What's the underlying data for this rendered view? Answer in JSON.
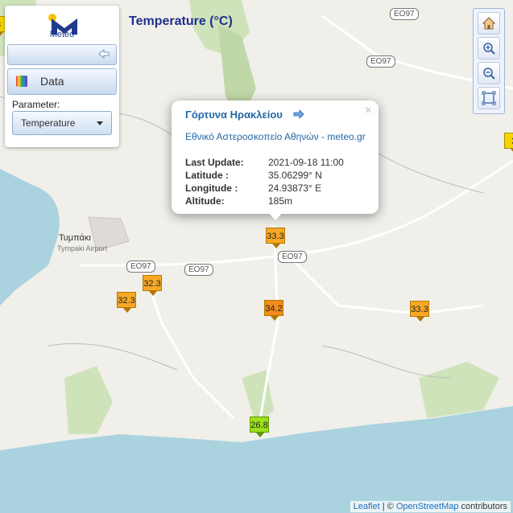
{
  "logo": {
    "text": "Meteo"
  },
  "panel": {
    "data_label": "Data",
    "parameter_label": "Parameter:",
    "parameter_value": "Temperature"
  },
  "map_title": "Temperature (°C)",
  "zoom": {
    "icons": [
      "home-icon",
      "zoom-in-icon",
      "zoom-out-icon",
      "fit-extent-icon"
    ]
  },
  "popup": {
    "station": "Γόρτυνα Ηρακλείου",
    "network": "Εθνικό Αστεροσκοπείο Αθηνών - meteo.gr",
    "rows": [
      {
        "label": "Last Update:",
        "value": "2021-09-18 11:00"
      },
      {
        "label": "Latitude :",
        "value": "35.06299° N"
      },
      {
        "label": "Longitude :",
        "value": "24.93873° E"
      },
      {
        "label": "Altitude:",
        "value": "185m"
      }
    ],
    "close": "×"
  },
  "markers": [
    {
      "value": "33.3",
      "color": "orange"
    },
    {
      "value": "32.3",
      "color": "orange"
    },
    {
      "value": "32.3",
      "color": "orange"
    },
    {
      "value": "34.2",
      "color": "dark-orange"
    },
    {
      "value": "33.3",
      "color": "orange"
    },
    {
      "value": "26.8",
      "color": "green"
    },
    {
      "value": "3",
      "color": "yellow"
    },
    {
      "value": "3",
      "color": "yellow"
    }
  ],
  "roads": [
    "EO97",
    "EO97",
    "EO97",
    "EO97",
    "EO97"
  ],
  "places": {
    "town": "Τυμπάκι",
    "airport": "Tympaki Airport"
  },
  "attribution": {
    "leaflet": "Leaflet",
    "separator": " | © ",
    "osm": "OpenStreetMap",
    "suffix": " contributors"
  }
}
